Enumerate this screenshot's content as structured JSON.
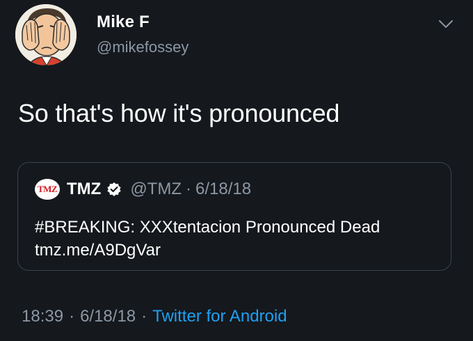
{
  "author": {
    "display_name": "Mike F",
    "handle": "@mikefossey"
  },
  "tweet": {
    "text": "So that's how it's pronounced"
  },
  "quote": {
    "logo_text": "TMZ",
    "display_name": "TMZ",
    "handle": "@TMZ",
    "separator": "·",
    "date": "6/18/18",
    "text_line1": "#BREAKING: XXXtentacion Pronounced Dead",
    "text_line2": "tmz.me/A9DgVar"
  },
  "footer": {
    "time": "18:39",
    "separator": "·",
    "date": "6/18/18",
    "source": "Twitter for Android"
  },
  "colors": {
    "background": "#15181d",
    "secondary_text": "#8b98a5",
    "link": "#1da1f2",
    "tmz_red": "#d4191f"
  },
  "icons": {
    "avatar": "cartoon-man-covering-face",
    "menu": "chevron-down-icon",
    "verified": "verified-badge-icon"
  }
}
